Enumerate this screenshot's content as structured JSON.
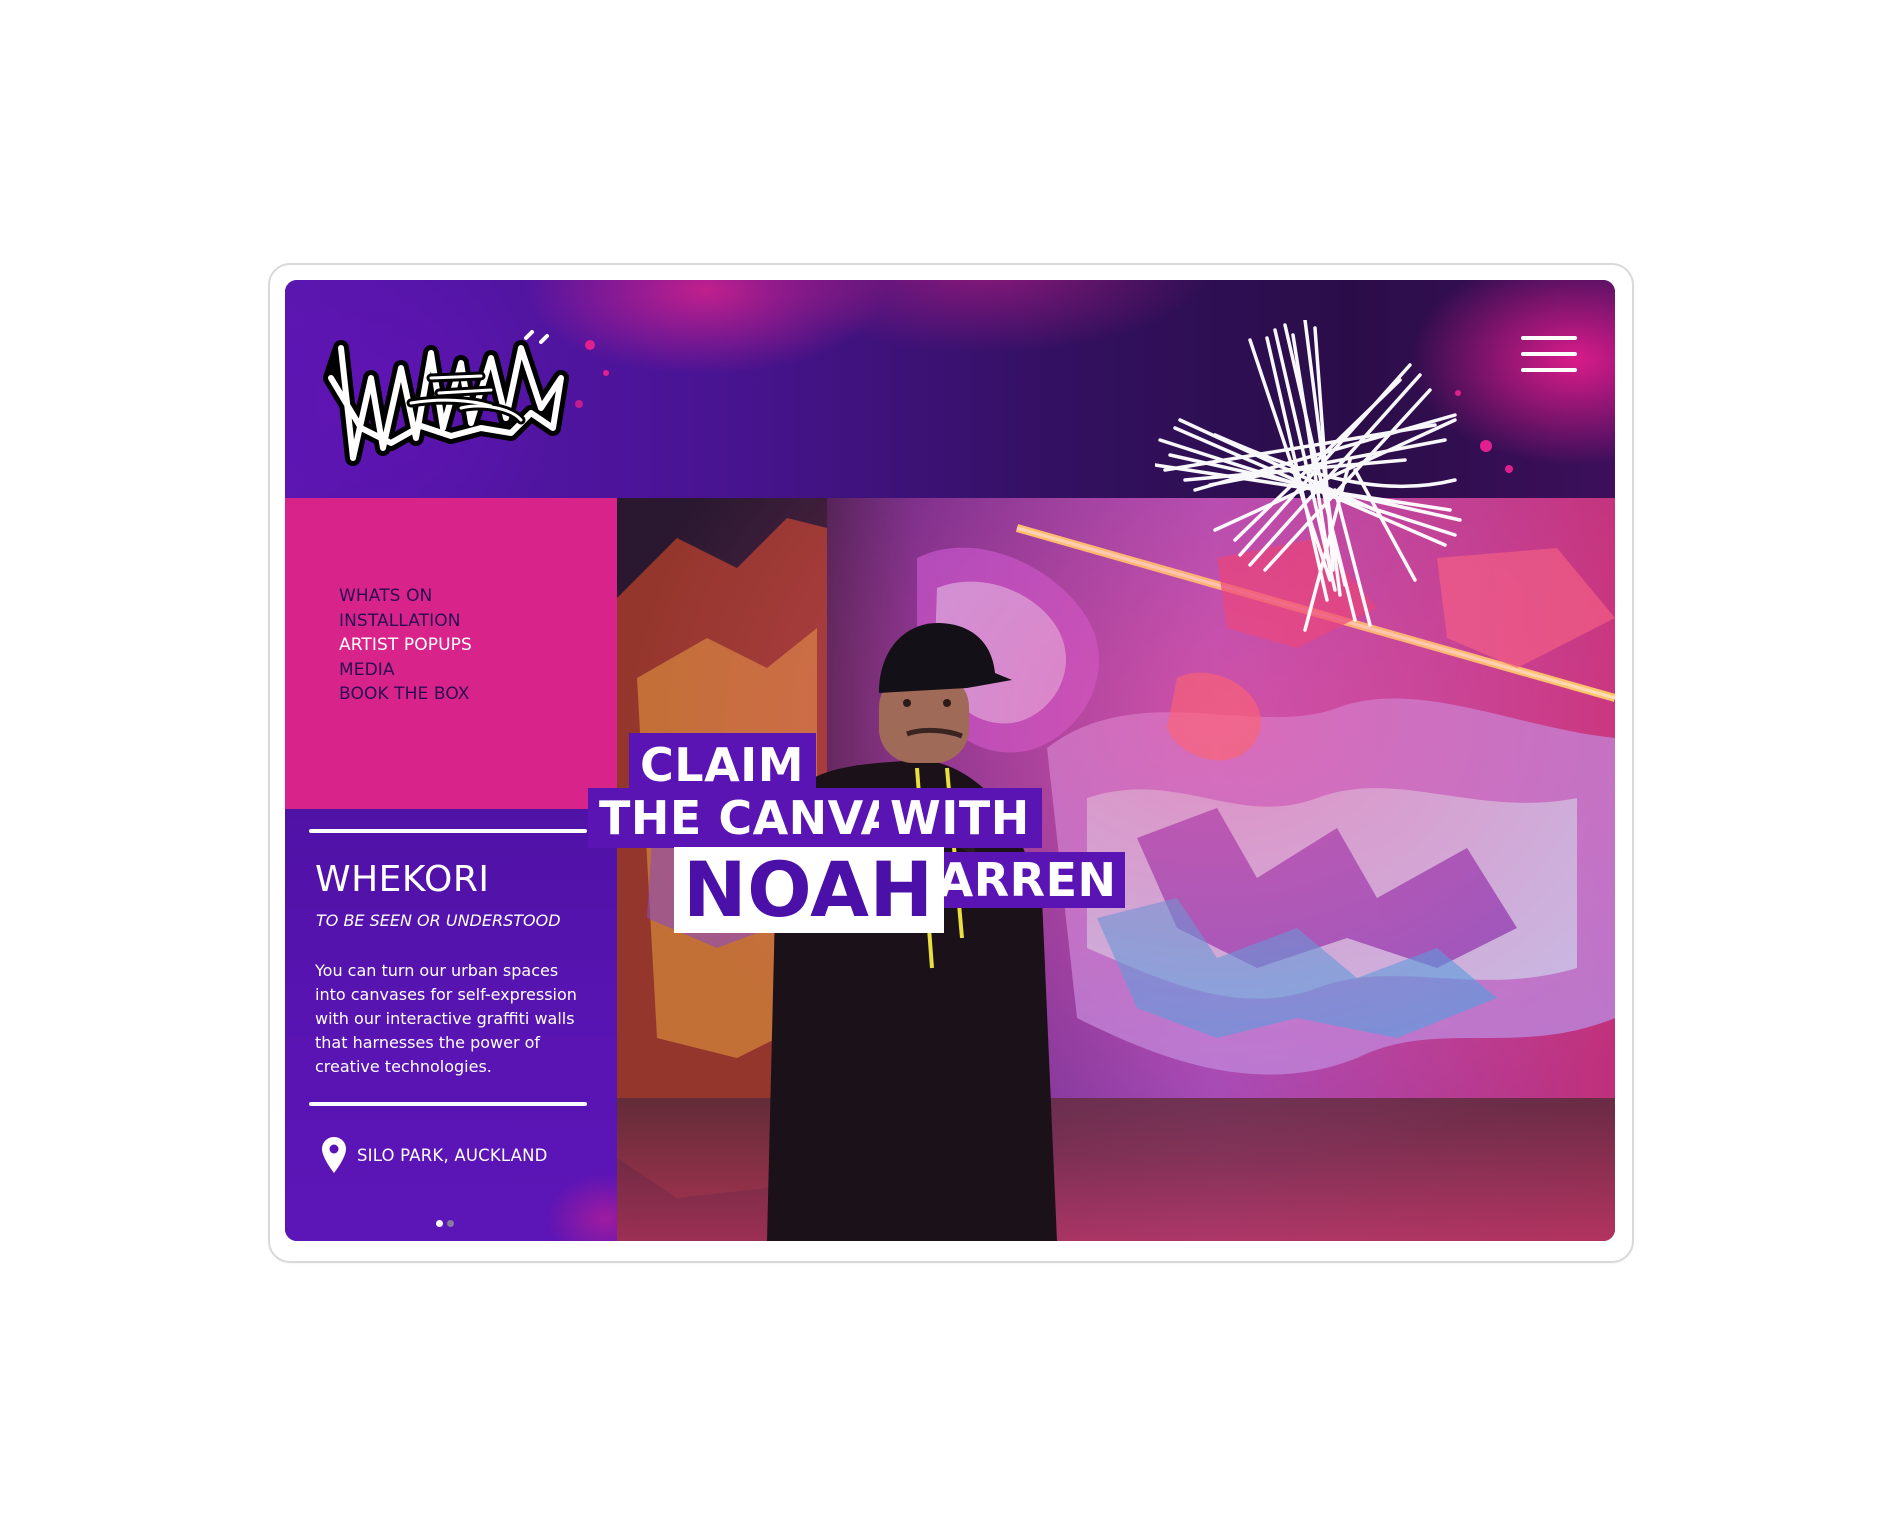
{
  "brand": {
    "logo_text": "WHEKORI"
  },
  "nav": {
    "items": [
      {
        "label": "WHATS ON",
        "active": false
      },
      {
        "label": "INSTALLATION",
        "active": false
      },
      {
        "label": "ARTIST POPUPS",
        "active": true
      },
      {
        "label": "MEDIA",
        "active": false
      },
      {
        "label": "BOOK THE BOX",
        "active": false
      }
    ]
  },
  "info": {
    "title": "WHEKORI",
    "subtitle": "TO BE SEEN OR UNDERSTOOD",
    "body": "You can turn our urban spaces into canvases for self-expression with our interactive graffiti walls that harnesses the power of creative technologies.",
    "location": "SILO PARK, AUCKLAND",
    "location_icon": "map-pin-icon",
    "slides": {
      "count": 2,
      "current": 1
    }
  },
  "headline": {
    "line1": "CLAIM",
    "line2a": "THE CANVAS",
    "line2b": "WITH",
    "line3a": "NOAH",
    "line3b": "FARREN"
  },
  "header": {
    "menu_icon": "hamburger-menu-icon"
  },
  "colors": {
    "brand_purple": "#5a14b4",
    "brand_magenta": "#d8248a",
    "nav_text": "#2a0a52",
    "white": "#ffffff"
  }
}
